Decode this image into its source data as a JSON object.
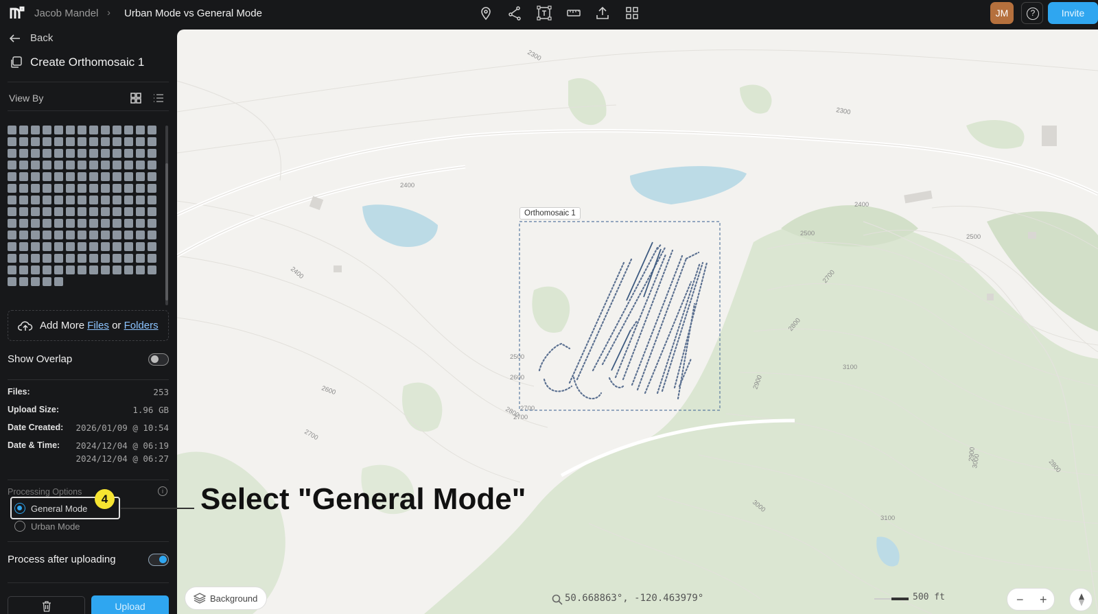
{
  "header": {
    "user_name": "Jacob Mandel",
    "separator": "›",
    "project_title": "Urban Mode vs General Mode",
    "avatar_initials": "JM",
    "help_label": "?",
    "invite_label": "Invite",
    "tool_icons": [
      "map-pin-icon",
      "share-nodes-icon",
      "area-measure-icon",
      "ruler-icon",
      "export-icon",
      "apps-grid-icon"
    ]
  },
  "sidebar": {
    "back_label": "Back",
    "create_title": "Create Orthomosaic 1",
    "view_by_label": "View By",
    "thumbnail_count": 174,
    "add_more": {
      "prefix": "Add More",
      "files_link": "Files",
      "or": "or",
      "folders_link": "Folders"
    },
    "show_overlap": {
      "label": "Show Overlap",
      "enabled": false
    },
    "info": {
      "files_label": "Files:",
      "files_value": "253",
      "upload_size_label": "Upload Size:",
      "upload_size_value": "1.96 GB",
      "date_created_label": "Date Created:",
      "date_created_value": "2026/01/09 @ 10:54",
      "date_time_label": "Date & Time:",
      "date_time_start": "2024/12/04 @ 06:19",
      "date_time_end": "2024/12/04 @ 06:27"
    },
    "processing_options": {
      "title": "Processing Options",
      "options": [
        {
          "label": "General Mode",
          "selected": true
        },
        {
          "label": "Urban Mode",
          "selected": false
        }
      ],
      "step_badge": "4"
    },
    "process_after_uploading": {
      "label": "Process after uploading",
      "enabled": true
    },
    "upload_label": "Upload"
  },
  "map": {
    "orthomosaic_label": "Orthomosaic 1",
    "background_label": "Background",
    "coordinates": "50.668863°, -120.463979°",
    "scale_label": "500 ft",
    "zoom_out": "−",
    "zoom_in": "+",
    "contour_labels": [
      "2300",
      "2300",
      "2400",
      "2400",
      "2500",
      "2400",
      "2700",
      "2500",
      "2800",
      "2600",
      "2700",
      "3100",
      "2900",
      "2800",
      "2700",
      "3000",
      "3100",
      "3000",
      "2900",
      "2800",
      "2500",
      "2600",
      "2700"
    ],
    "callout_text": "Select \"General Mode\""
  },
  "colors": {
    "accent": "#2fa6f0",
    "badge": "#f6e431",
    "avatar": "#b5703d",
    "map_bg": "#f3f2ef",
    "vegetation": "#dbe6d2",
    "water": "#bcdbe6"
  }
}
